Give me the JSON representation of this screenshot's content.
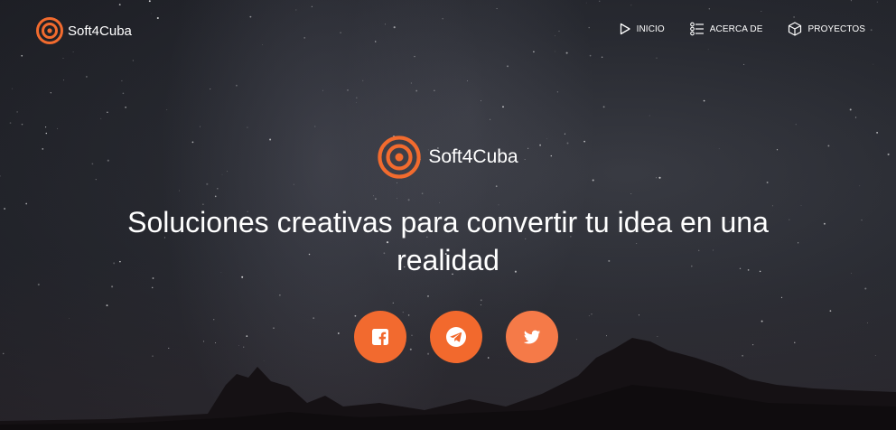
{
  "colors": {
    "accent": "#f26b2e",
    "social_facebook": "#f26a2f",
    "social_telegram": "#f2692d",
    "social_twitter": "#f57a48"
  },
  "header": {
    "brand_name": "Soft4Cuba",
    "logo_icon": "target-logo-icon",
    "nav": [
      {
        "label": "INICIO",
        "icon": "play-outline-icon"
      },
      {
        "label": "ACERCA DE",
        "icon": "list-icon"
      },
      {
        "label": "PROYECTOS",
        "icon": "cube-icon"
      }
    ]
  },
  "hero": {
    "brand_name": "Soft4Cuba",
    "headline": "Soluciones creativas para convertir tu idea en una realidad",
    "socials": [
      {
        "icon": "facebook-icon"
      },
      {
        "icon": "telegram-icon"
      },
      {
        "icon": "twitter-icon"
      }
    ]
  }
}
